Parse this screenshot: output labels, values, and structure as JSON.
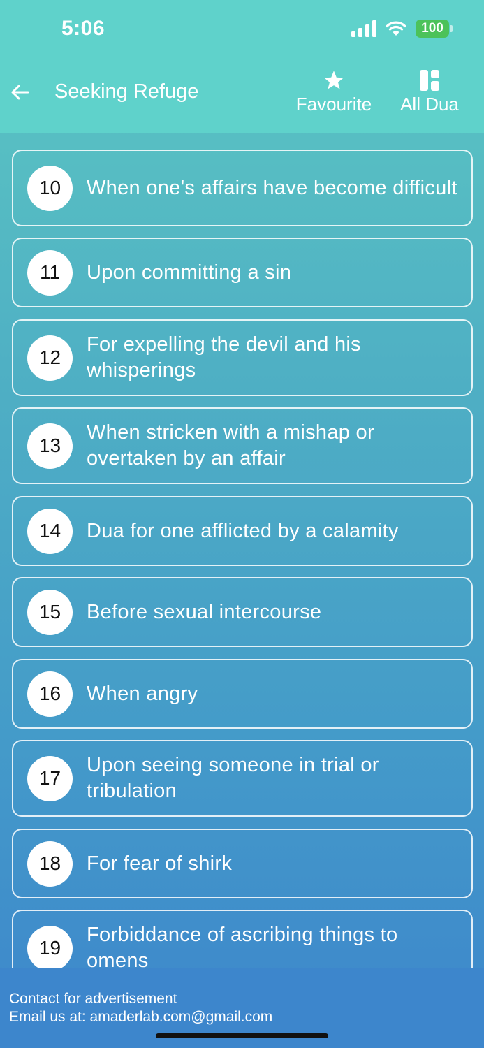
{
  "status_bar": {
    "time": "5:06",
    "battery": "100"
  },
  "header": {
    "title": "Seeking Refuge",
    "favourite_label": "Favourite",
    "all_dua_label": "All Dua"
  },
  "items": [
    {
      "number": "10",
      "text": "When one's affairs have become difficult"
    },
    {
      "number": "11",
      "text": "Upon committing a sin"
    },
    {
      "number": "12",
      "text": "For expelling the devil and his whisperings"
    },
    {
      "number": "13",
      "text": "When stricken with a mishap or overtaken by an affair"
    },
    {
      "number": "14",
      "text": "Dua for one afflicted by a calamity"
    },
    {
      "number": "15",
      "text": "Before sexual intercourse"
    },
    {
      "number": "16",
      "text": "When angry"
    },
    {
      "number": "17",
      "text": "Upon seeing someone in trial or tribulation"
    },
    {
      "number": "18",
      "text": "For fear of shirk"
    },
    {
      "number": "19",
      "text": "Forbiddance of ascribing things to omens"
    }
  ],
  "footer": {
    "line1": "Contact for advertisement",
    "line2": "Email us at: amaderlab.com@gmail.com"
  },
  "colors": {
    "header": "#5fd2cb",
    "gradient_top": "#5cc7c2",
    "gradient_bottom": "#3d86cc",
    "battery": "#4cc25a"
  }
}
